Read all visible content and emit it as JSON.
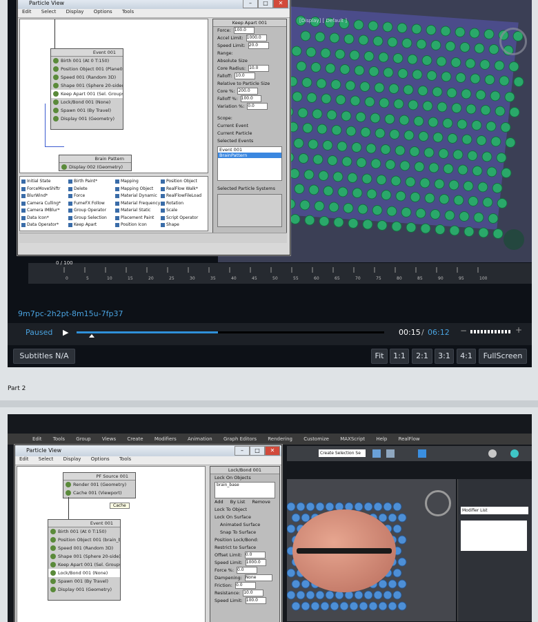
{
  "part1": {
    "particle_view": {
      "title": "Particle View",
      "menu": [
        "Edit",
        "Select",
        "Display",
        "Options",
        "Tools"
      ],
      "event001": {
        "header": "Event 001",
        "ops": [
          "Birth 001 (At 0 T:150)",
          "Position Object 001 (Plane01)",
          "Speed 001 (Random 3D)",
          "Shape 001 (Sphere 20-sided)",
          "Keep Apart 001 (Sel. Groups)",
          "Lock/Bond 001 (None)",
          "Spawn 001 (By Travel)",
          "Display 001 (Geometry)"
        ]
      },
      "brain_pattern": {
        "header": "Brain Pattern",
        "ops": [
          "Display 002 (Geometry)"
        ]
      },
      "props": {
        "title": "Keep Apart 001",
        "rows": [
          {
            "label": "Force:",
            "value": "100.0"
          },
          {
            "label": "Accel Limit:",
            "value": "1000.0"
          },
          {
            "label": "Speed Limit:",
            "value": "20.0"
          }
        ],
        "range_label": "Range:",
        "range_opts": [
          "Absolute Size",
          "Relative to Particle Size"
        ],
        "range_rows": [
          {
            "label": "Core Radius:",
            "value": "10.0"
          },
          {
            "label": "Falloff:",
            "value": "10.0"
          },
          {
            "label": "Core %:",
            "value": "200.0"
          },
          {
            "label": "Falloff %:",
            "value": "100.0"
          },
          {
            "label": "Variation %:",
            "value": "0.0"
          }
        ],
        "scope_label": "Scope:",
        "scope_opts": [
          "Current Event",
          "Current Particle",
          "Selected Events"
        ],
        "events": [
          "Event 001",
          "BrainPattern"
        ],
        "selected_systems": "Selected Particle Systems"
      },
      "depot": [
        [
          "Initial State",
          "ForceMoveShiftr",
          "BlurWind*",
          "Camera Culling*",
          "Camera IMBlur*",
          "Data Icon*",
          "Data Operator*"
        ],
        [
          "Birth Paint*",
          "Delete",
          "Force",
          "FumeFX Follow",
          "Group Operator",
          "Group Selection",
          "Keep Apart"
        ],
        [
          "Mapping",
          "Mapping Object",
          "Material Dynamic",
          "Material Frequency",
          "Material Static",
          "Placement Paint",
          "Position Icon"
        ],
        [
          "Position Object",
          "RealFlow Walk*",
          "RealFlowFileLoad",
          "Rotation",
          "Scale",
          "Script Operator",
          "Shape"
        ]
      ]
    },
    "viewport_label": "[Display] [ Default ]",
    "timeline": {
      "frame": "0 / 100",
      "ticks": [
        "0",
        "5",
        "10",
        "15",
        "20",
        "25",
        "30",
        "35",
        "40",
        "45",
        "50",
        "55",
        "60",
        "65",
        "70",
        "75",
        "80",
        "85",
        "90",
        "95",
        "100"
      ]
    },
    "video_id": "9m7pc-2h2pt-8m15u-7fp37",
    "player": {
      "status": "Paused",
      "current": "00:15",
      "separator": "/",
      "total": "06:12",
      "progress": 0.46
    },
    "subtitles": "Subtitles N/A",
    "zoom_buttons": [
      "Fit",
      "1:1",
      "2:1",
      "3:1",
      "4:1",
      "FullScreen"
    ]
  },
  "part_label": "Part 2",
  "part2": {
    "menu": [
      "Edit",
      "Tools",
      "Group",
      "Views",
      "Create",
      "Modifiers",
      "Animation",
      "Graph Editors",
      "Rendering",
      "Customize",
      "MAXScript",
      "Help",
      "RealFlow"
    ],
    "create_selection": "Create Selection Se",
    "particle_view": {
      "title": "Particle View",
      "menu": [
        "Edit",
        "Select",
        "Display",
        "Options",
        "Tools"
      ],
      "pf_source": {
        "header": "PF Source 001",
        "ops": [
          "Render 001 (Geometry)",
          "Cache 001 (Viewport)"
        ]
      },
      "tooltip": "Cache",
      "event001": {
        "header": "Event 001",
        "ops": [
          "Birth 001 (At 0 T:150)",
          "Position Object 001 (brain_b",
          "Speed 001 (Random 3D)",
          "Shape 001 (Sphere 20-side)",
          "Keep Apart 001 (Sel. Groups)",
          "Lock/Bond 001 (None)",
          "Spawn 001 (By Travel)",
          "Display 001 (Geometry)"
        ]
      },
      "props": {
        "title": "Lock/Bond 001",
        "section": "Lock On Objects",
        "object": "brain_base",
        "tabs": [
          "Add",
          "By List",
          "Remove"
        ],
        "opts": [
          "Lock To Object",
          "Lock On Surface",
          "Animated Surface",
          "Snap To Surface"
        ],
        "pos_label": "Position Lock/Bond:",
        "restrict": "Restrict to Surface",
        "rows": [
          {
            "label": "Offset Limit:",
            "value": "0.0"
          },
          {
            "label": "Speed Limit:",
            "value": "1000.0"
          },
          {
            "label": "Force %:",
            "value": "0.0"
          }
        ],
        "dampening_label": "Dampening:",
        "dampening": "None",
        "rows2": [
          {
            "label": "Friction:",
            "value": "0.0"
          },
          {
            "label": "Resistance:",
            "value": "10.0"
          },
          {
            "label": "Speed Limit:",
            "value": "100.0"
          }
        ]
      }
    },
    "modifier_list": "Modifier List"
  }
}
